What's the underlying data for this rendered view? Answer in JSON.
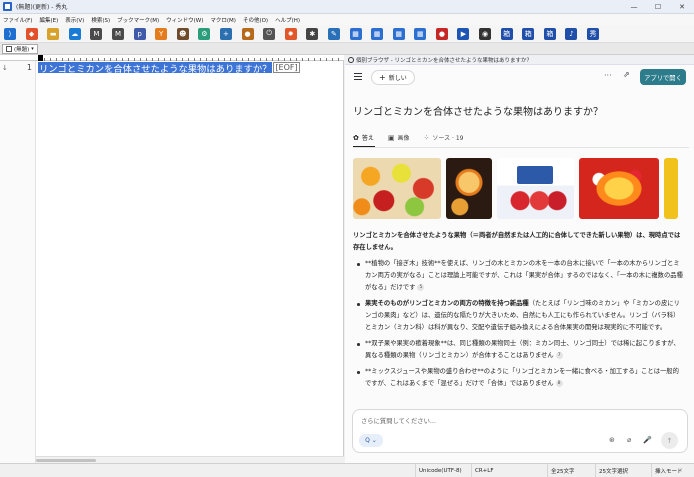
{
  "window": {
    "title": "(無題)(更新) - 秀丸",
    "controls": [
      "—",
      "☐",
      "✕"
    ]
  },
  "menu": [
    "ファイル(F)",
    "編集(E)",
    "表示(V)",
    "検索(S)",
    "ブックマーク(M)",
    "ウィンドウ(W)",
    "マクロ(M)",
    "その他(O)",
    "ヘルプ(H)"
  ],
  "toolbar": {
    "icons": [
      {
        "name": "vscode-icon",
        "glyph": "⟩",
        "color": "#1f6fd0"
      },
      {
        "name": "git-icon",
        "glyph": "◆",
        "color": "#e2512c"
      },
      {
        "name": "folder-icon",
        "glyph": "▬",
        "color": "#d8a12a"
      },
      {
        "name": "cloud-icon",
        "glyph": "☁",
        "color": "#1a7bd4"
      },
      {
        "name": "markdown-icon",
        "glyph": "M",
        "color": "#4a4a4a"
      },
      {
        "name": "markdown-down-icon",
        "glyph": "M",
        "color": "#4a4a4a"
      },
      {
        "name": "php-icon",
        "glyph": "p",
        "color": "#3f5aa8"
      },
      {
        "name": "bookmark-star-icon",
        "glyph": "Y",
        "color": "#e47c1d"
      },
      {
        "name": "monkey-icon",
        "glyph": "☻",
        "color": "#6f4b2b"
      },
      {
        "name": "gear-icon",
        "glyph": "⚙",
        "color": "#2c9d7a"
      },
      {
        "name": "plus-circle-icon",
        "glyph": "+",
        "color": "#2c6fb0"
      },
      {
        "name": "coffee-icon",
        "glyph": "●",
        "color": "#b56b1b"
      },
      {
        "name": "power-icon",
        "glyph": "⏻",
        "color": "#555555"
      },
      {
        "name": "sun-icon",
        "glyph": "✹",
        "color": "#e2572a"
      },
      {
        "name": "bug-icon",
        "glyph": "✱",
        "color": "#444444"
      },
      {
        "name": "pen-icon",
        "glyph": "✎",
        "color": "#2a70b8"
      },
      {
        "name": "window-icon",
        "glyph": "▦",
        "color": "#2d6fd1"
      },
      {
        "name": "window-left-icon",
        "glyph": "▦",
        "color": "#2d6fd1"
      },
      {
        "name": "window-right-icon",
        "glyph": "▦",
        "color": "#2d6fd1"
      },
      {
        "name": "window-split-icon",
        "glyph": "▦",
        "color": "#2d6fd1"
      },
      {
        "name": "record-icon",
        "glyph": "●",
        "color": "#c62828"
      },
      {
        "name": "play-icon",
        "glyph": "▶",
        "color": "#1e55b3"
      },
      {
        "name": "run-icon",
        "glyph": "◉",
        "color": "#333333"
      },
      {
        "name": "kanji-icon-1",
        "glyph": "箱",
        "color": "#1f4fa8"
      },
      {
        "name": "kanji-icon-2",
        "glyph": "箱",
        "color": "#1f4fa8"
      },
      {
        "name": "kanji-icon-3",
        "glyph": "箱",
        "color": "#1f4fa8"
      },
      {
        "name": "bell-icon",
        "glyph": "♪",
        "color": "#1f4fa8"
      },
      {
        "name": "kanji-icon-4",
        "glyph": "秀",
        "color": "#1f4fa8"
      }
    ]
  },
  "tab": {
    "label": "(無題)",
    "dropdown": "▾"
  },
  "editor": {
    "line_number": "1",
    "selected_text": "リンゴとミカンを合体させたような果物はありますか？",
    "eof": "[EOF]",
    "caret_marker": "↓"
  },
  "browser": {
    "window_title": "個別ブラウザ - リンゴとミカンを合体させたような果物はありますか？",
    "new_label": "新しい",
    "more_glyph": "···",
    "share_glyph": "⇗",
    "open_app_label": "アプリで開く",
    "query": "リンゴとミカンを合体させたような果物はありますか？",
    "tabs": [
      {
        "icon": "✿",
        "label": "答え"
      },
      {
        "icon": "▣",
        "label": "画像"
      },
      {
        "icon": "⁘",
        "label": "ソース · 19"
      }
    ],
    "answer": {
      "lead": "リンゴとミカンを合体させたような果物（＝両者が自然または人工的に合体してできた新しい果物）は、現時点では存在しません。",
      "bullets": [
        {
          "bold": "",
          "text": "**植物の「接ぎ木」技術**を使えば、リンゴの木とミカンの木を一本の台木に接いで「一本の木からリンゴとミカン両方の実がなる」ことは理論上可能ですが、これは「果実が合体」するのではなく、「一本の木に複数の品種がなる」だけです",
          "cite": "5"
        },
        {
          "bold": "果実そのものがリンゴとミカンの両方の特徴を持つ新品種",
          "text": "（たとえば「リンゴ味のミカン」や「ミカンの皮にリンゴの果肉」など）は、遺伝的な隔たりが大きいため、自然にも人工にも作られていません。リンゴ（バラ科）とミカン（ミカン科）は科が異なり、交配や遺伝子組み換えによる合体果実の開発は現実的に不可能です。",
          "cite": ""
        },
        {
          "bold": "",
          "text": "**双子果や果実の癒着現象**は、同じ種類の果物同士（例：ミカン同士、リンゴ同士）では稀に起こりますが、異なる種類の果物（リンゴとミカン）が合体することはありません",
          "cite": "7"
        },
        {
          "bold": "",
          "text": "**ミックスジュースや果物の盛り合わせ**のように「リンゴとミカンを一緒に食べる・加工する」ことは一般的ですが、これはあくまで「混ぜる」だけで「合体」ではありません",
          "cite": "8"
        }
      ]
    },
    "input": {
      "placeholder": "さらに質問してください...",
      "search_glyph": "Q ⌄",
      "icons": [
        "⊛",
        "⌀",
        "🎤"
      ],
      "send_glyph": "↑"
    }
  },
  "status": {
    "encoding": "Unicode(UTF-8)",
    "line_ending": "CR+LF",
    "char_count": "全25文字",
    "selection": "25文字選択",
    "mode": "挿入モード"
  }
}
